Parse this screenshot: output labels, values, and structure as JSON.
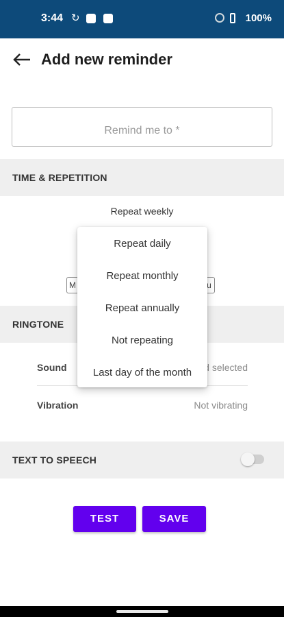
{
  "status_bar": {
    "time": "3:44",
    "battery": "100%"
  },
  "header": {
    "title": "Add new reminder"
  },
  "reminder_input": {
    "placeholder": "Remind me to *"
  },
  "time_section": {
    "title": "TIME & REPETITION",
    "repeat_value": "Repeat weekly",
    "day_chip_left": "M",
    "day_chip_right": "u"
  },
  "repeat_menu": {
    "items": [
      "Repeat daily",
      "Repeat monthly",
      "Repeat annually",
      "Not repeating",
      "Last day of the month"
    ]
  },
  "ringtone_section": {
    "title": "RINGTONE",
    "sound_label": "Sound",
    "sound_value": "d selected",
    "vibration_label": "Vibration",
    "vibration_value": "Not vibrating"
  },
  "tts_section": {
    "title": "TEXT TO SPEECH",
    "enabled": false
  },
  "actions": {
    "test_label": "TEST",
    "save_label": "SAVE"
  },
  "colors": {
    "status_bar": "#0d4a7a",
    "accent": "#6200ee"
  }
}
